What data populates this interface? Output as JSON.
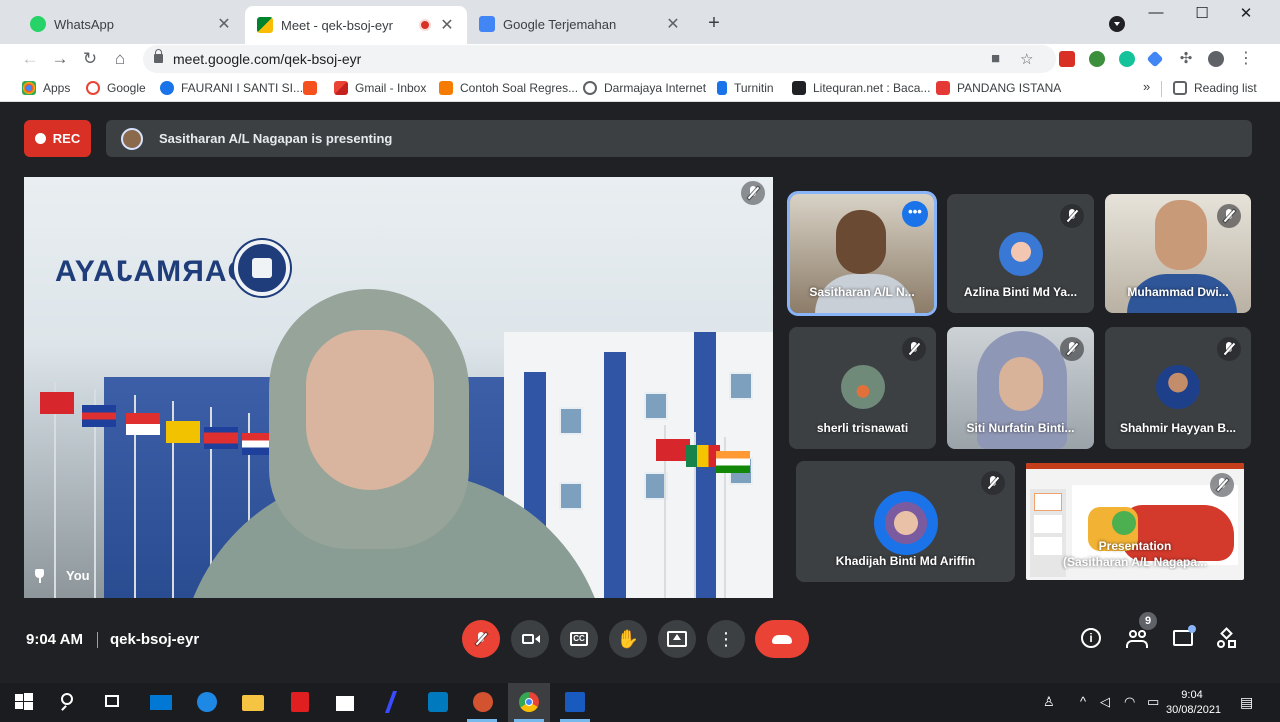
{
  "browser": {
    "tabs": [
      {
        "title": "WhatsApp",
        "close": "✕"
      },
      {
        "title": "Meet - qek-bsoj-eyr",
        "close": "✕"
      },
      {
        "title": "Google Terjemahan",
        "close": "✕"
      }
    ],
    "new_tab": "+",
    "window_controls": {
      "minimize": "—",
      "maximize": "☐",
      "close": "✕"
    },
    "url": "meet.google.com/qek-bsoj-eyr",
    "bookmarks": [
      {
        "label": "Apps",
        "color": "#4285f4"
      },
      {
        "label": "Google",
        "color": "#ea4335"
      },
      {
        "label": "FAURANI I SANTI SI...",
        "color": "#1a73e8"
      },
      {
        "label": "",
        "color": "#f4511e"
      },
      {
        "label": "Gmail - Inbox",
        "color": "#ea4335"
      },
      {
        "label": "Contoh Soal Regres...",
        "color": "#f57c00"
      },
      {
        "label": "Darmajaya Internet",
        "color": "#5f6368"
      },
      {
        "label": "Turnitin",
        "color": "#1a73e8"
      },
      {
        "label": "Litequran.net : Baca...",
        "color": "#202124"
      },
      {
        "label": "PANDANG ISTANA",
        "color": "#e53935"
      }
    ],
    "bookmarks_more": "»",
    "reading_list": "Reading list"
  },
  "meet": {
    "rec_label": "REC",
    "presenting_text": "Sasitharan A/L Nagapan is presenting",
    "main_video_label": "You",
    "logo_text": "DARMAJAYA",
    "participants": [
      {
        "name": "Sasitharan A/L N...",
        "more": "•••"
      },
      {
        "name": "Azlina Binti Md Ya..."
      },
      {
        "name": "Muhammad Dwi..."
      },
      {
        "name": "sherli trisnawati"
      },
      {
        "name": "Siti Nurfatin Binti..."
      },
      {
        "name": "Shahmir Hayyan B..."
      },
      {
        "name": "Khadijah Binti Md Ariffin"
      },
      {
        "name": "Presentation\n(Sasitharan A/L Nagapa..."
      }
    ],
    "time": "9:04 AM",
    "meeting_code": "qek-bsoj-eyr",
    "participant_count": "9",
    "accent_color": "#8ab4f8",
    "end_call_color": "#ea4335"
  },
  "taskbar": {
    "time": "9:04",
    "date": "30/08/2021"
  }
}
